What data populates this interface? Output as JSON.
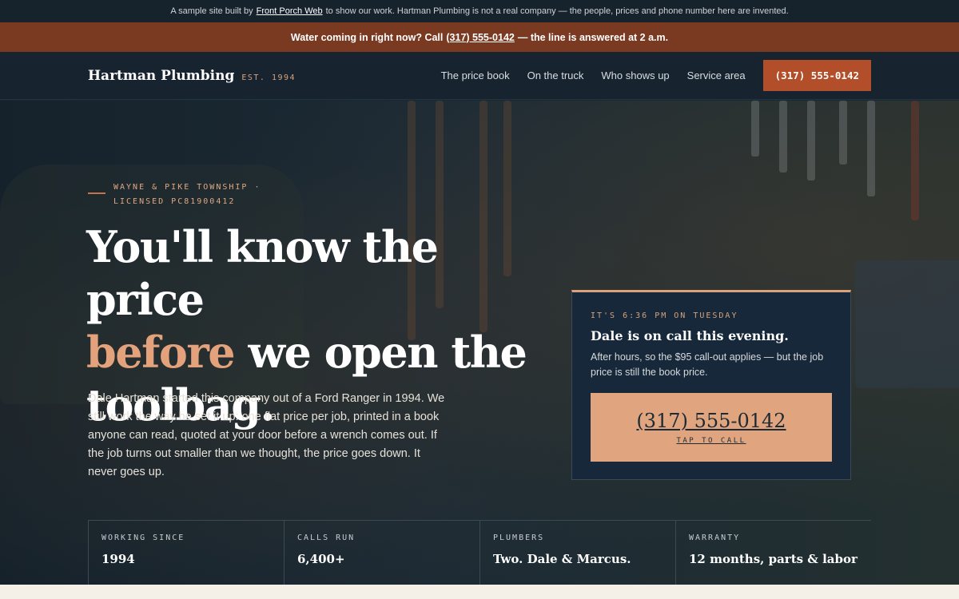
{
  "disclaimer": {
    "prefix": "A sample site built by",
    "link": "Front Porch Web",
    "suffix": "to show our work. Hartman Plumbing is not a real company — the people, prices and phone number here are invented."
  },
  "alert": {
    "prefix": "Water coming in right now? Call",
    "phone": "(317) 555-0142",
    "suffix": "— the line is answered at 2 a.m."
  },
  "nav": {
    "brand": "Hartman Plumbing",
    "established": "EST. 1994",
    "links": [
      "The price book",
      "On the truck",
      "Who shows up",
      "Service area"
    ],
    "cta": "(317) 555-0142"
  },
  "hero": {
    "eyebrow": "WAYNE & PIKE TOWNSHIP · LICENSED PC81900412",
    "headline_line1": "You'll know the price",
    "headline_accent": "before",
    "headline_line2": "we open the",
    "headline_line3": "toolbag.",
    "intro": "Dale Hartman started this company out of a Ford Ranger in 1994. We still work the way he set it up: one flat price per job, printed in a book anyone can read, quoted at your door before a wrench comes out. If the job turns out smaller than we thought, the price goes down. It never goes up."
  },
  "oncall": {
    "time": "IT'S 6:36 PM ON TUESDAY",
    "title": "Dale is on call this evening.",
    "text": "After hours, so the $95 call-out applies — but the job price is still the book price.",
    "phone": "(317) 555-0142",
    "tap": "TAP TO CALL"
  },
  "stats": [
    {
      "label": "WORKING SINCE",
      "value": "1994"
    },
    {
      "label": "CALLS RUN",
      "value": "6,400+"
    },
    {
      "label": "PLUMBERS",
      "value": "Two. Dale & Marcus."
    },
    {
      "label": "WARRANTY",
      "value": "12 months, parts & labor"
    }
  ],
  "colors": {
    "alert_bg": "#7a3a22",
    "accent": "#e0a57e",
    "cta_bg": "#b24f2a",
    "navy": "#172430"
  }
}
